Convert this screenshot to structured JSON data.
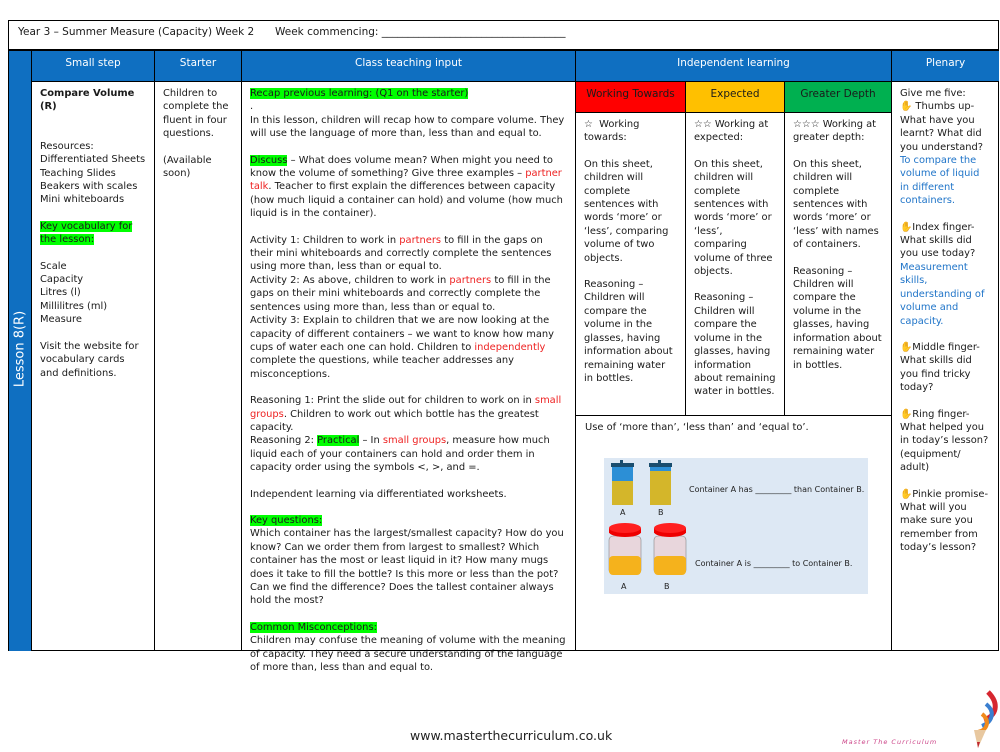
{
  "title_bar": {
    "title": "Year 3 – Summer Measure (Capacity)  Week 2",
    "week_commencing": "Week commencing: ___________________________________"
  },
  "side_label": "Lesson 8(R)",
  "headers": {
    "small_step": "Small step",
    "starter": "Starter",
    "class_teaching": "Class teaching input",
    "independent": "Independent learning",
    "plenary": "Plenary"
  },
  "small_step": {
    "title": "Compare Volume (R)",
    "resources_label": "Resources:",
    "resources": [
      "Differentiated Sheets",
      "Teaching Slides",
      "Beakers with scales",
      "Mini whiteboards"
    ],
    "vocab_label": "Key vocabulary for the lesson:",
    "vocab": [
      "Scale",
      "Capacity",
      "Litres (l)",
      "Millilitres (ml)",
      "Measure"
    ],
    "website_note": "Visit the website for vocabulary cards and definitions."
  },
  "starter": {
    "text": "Children to complete the fluent in four questions.",
    "availability": "(Available soon)"
  },
  "teaching": {
    "recap_label": "Recap previous learning: (Q1 on the starter)",
    "dot": ".",
    "intro": "In this lesson, children will recap how to compare volume. They will use the language of more than, less than and equal to.",
    "discuss_label": "Discuss",
    "discuss_a": " – What does volume mean? When might you need to know the volume of something? Give three examples – ",
    "discuss_red": "partner talk",
    "discuss_b": ". Teacher to first explain the differences between capacity (how much liquid a container can hold) and volume (how much liquid is in the container).",
    "act1_a": "Activity 1:  Children to work in ",
    "act1_red": "partners",
    "act1_b": " to fill in the gaps on their mini whiteboards and correctly complete the sentences using more than, less than or equal to.",
    "act2_a": "Activity 2:  As above, children to work in ",
    "act2_red": "partners",
    "act2_b": " to fill in the gaps on their mini whiteboards and correctly complete the sentences using more than, less than or equal to.",
    "act3_a": "Activity 3: Explain to children that we are now looking at the capacity of different containers – we want to know how many cups of water each one can hold. Children to ",
    "act3_red": "independently",
    "act3_b": " complete the questions, while teacher addresses any misconceptions.",
    "r1_a": "Reasoning 1: Print the slide out for children to work on in ",
    "r1_red": "small groups",
    "r1_b": ". Children to work out which bottle has the greatest capacity.",
    "r2_a": "Reasoning 2: ",
    "r2_hl": "Practical",
    "r2_b": " – In ",
    "r2_red": "small groups",
    "r2_c": ", measure how much liquid each of your containers can hold and order them in capacity order using the symbols <, >, and =.",
    "independent_note": "Independent learning via differentiated worksheets.",
    "kq_label": "Key questions:",
    "kq_text": "Which container has the largest/smallest capacity? How do you know? Can we order them from largest to smallest? Which container has the most or least liquid in it? How many mugs does it take to fill the bottle? Is this more or less than the pot? Can we find the difference? Does the tallest container always hold the most?",
    "cm_label": "Common Misconceptions:",
    "cm_text": "Children may confuse the meaning of volume with the meaning of capacity. They need a secure understanding of the language of more than, less than and equal to."
  },
  "levels": [
    {
      "name": "Working Towards",
      "color": "#ff0000",
      "stars": "☆",
      "heading": "Working towards:",
      "desc": "On this sheet, children will complete sentences with words ‘more’ or ‘less’, comparing volume of two objects.",
      "reasoning": "Reasoning – Children will compare the volume in the glasses, having information about remaining water in bottles."
    },
    {
      "name": "Expected",
      "color": "#ffc000",
      "stars": "☆☆",
      "heading": "Working at expected:",
      "desc": "On this sheet, children will complete sentences with words ‘more’ or ‘less’, comparing volume of three objects.",
      "reasoning": "Reasoning – Children will compare the volume in the glasses, having information about remaining water in bottles."
    },
    {
      "name": "Greater Depth",
      "color": "#00b050",
      "stars": "☆☆☆",
      "heading": "Working at greater depth:",
      "desc": "On this sheet, children will complete sentences with words ‘more’ or ‘less’ with names of containers.",
      "reasoning": "Reasoning – Children will compare the volume in the glasses, having information about remaining water in bottles."
    }
  ],
  "usage": {
    "text": "Use of ‘more than’, ‘less than’ and ‘equal to’.",
    "sentence1": "Container A has _________ than Container B.",
    "sentence2": "Container A is _________ to Container B.",
    "label_a": "A",
    "label_b": "B"
  },
  "plenary": {
    "intro": "Give me five:",
    "thumb_q": " Thumbs up- What have you learnt? What did you understand?",
    "thumb_a": "To compare the volume of liquid in different containers.",
    "index_q": "Index finger- What skills did you use today?",
    "index_a": "Measurement skills, understanding of volume and capacity.",
    "middle_q": "Middle finger- What skills did you find tricky today?",
    "ring_q": "Ring finger- What helped you in today’s lesson? (equipment/ adult)",
    "pinkie_q": "Pinkie promise- What will you make sure you remember from today’s lesson?"
  },
  "footer": {
    "url": "www.masterthecurriculum.co.uk",
    "logo_text": "Master The Curriculum"
  }
}
